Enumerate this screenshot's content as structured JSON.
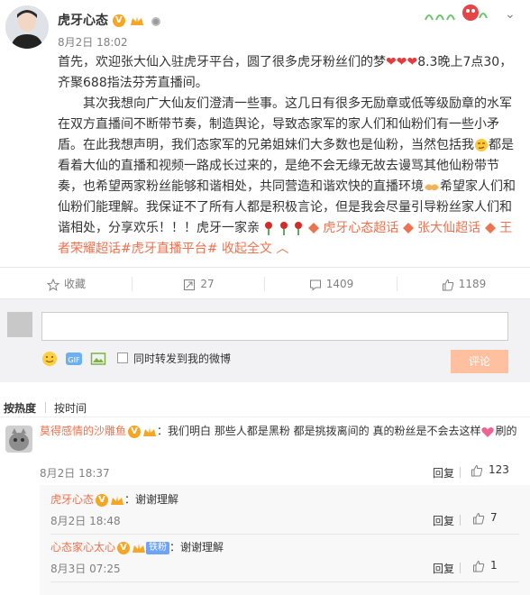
{
  "post": {
    "author": "虎牙心态",
    "time": "8月2日 18:02",
    "para1_a": "首先，欢迎张大仙入驻虎牙平台，圆了很多虎牙粉丝们的梦",
    "para1_hearts": "❤❤❤",
    "para1_b": "8.3晚上7点30，齐聚688指法芬芳直播间。",
    "para2_a": "其次我想向广大仙友们澄清一些事。这几日有很多无励章或低等级励章的水军在双方直播间不断带节奏，制造舆论，导致态家军的家人们和仙粉们有一些小矛盾。在此我想声明，我们态家军的兄弟姐妹们大多数也是仙粉，当然包括我",
    "para2_b": "都是看着大仙的直播和视频一路成长过来的，是绝不会无缘无故去谩骂其他仙粉带节奏，也希望两家粉丝能够和谐相处，共同营造和谐欢快的直播环境",
    "para2_c": "希望家人们和仙粉们能理解。我保证不了所有人都是积极言论，但是我会尽量引导粉丝家人们和谐相处，分享欢乐！！！虎牙一家亲",
    "topic1": "虎牙心态超话",
    "topic2": "张大仙超话",
    "topic3": "王者荣耀超话#虎牙直播平台#",
    "collapse": "收起全文"
  },
  "actions": {
    "fav": "收藏",
    "forward": "27",
    "comment": "1409",
    "like": "1189"
  },
  "composer": {
    "forward_label": "同时转发到我的微博",
    "submit": "评论"
  },
  "sort": {
    "hot": "按热度",
    "time": "按时间"
  },
  "comments": [
    {
      "name": "莫得感情的沙雕鱼",
      "text_a": "：我们明白 那些人都是黑粉 都是挑拨离间的 真的粉丝是不会去这样",
      "text_b": "刷的",
      "time": "8月2日 18:37",
      "reply": "回复",
      "likes": "123"
    }
  ],
  "replies": [
    {
      "name": "虎牙心态",
      "text": "：谢谢理解",
      "time": "8月2日 18:48",
      "reply": "回复",
      "likes": "7"
    },
    {
      "name": "心态家心太心",
      "badge": "铁粉",
      "text": "：谢谢理解",
      "time": "8月3日 07:25",
      "reply": "回复",
      "likes": "1"
    }
  ],
  "colors": {
    "accent": "#eb7350",
    "submit_bg": "#ffc09f"
  }
}
